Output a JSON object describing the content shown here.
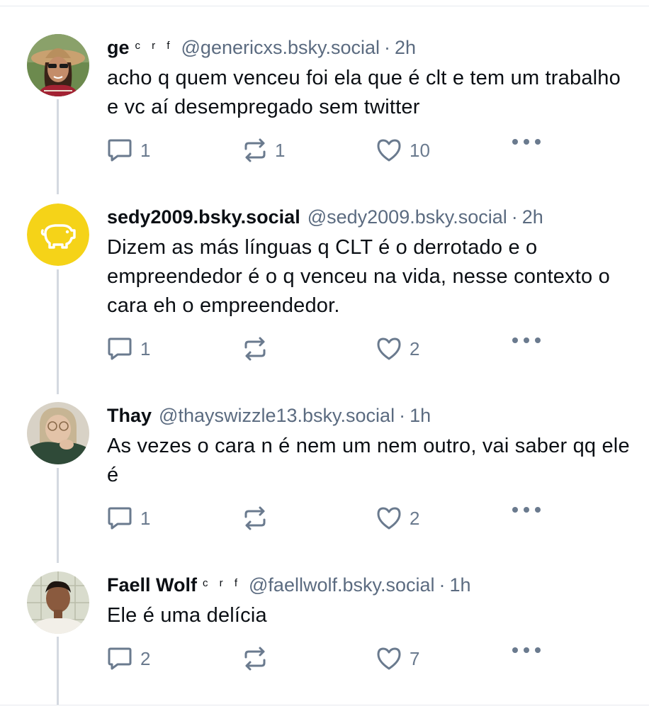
{
  "posts": [
    {
      "name": "ge",
      "name_suffix": "c r f",
      "handle": "@genericxs.bsky.social",
      "time": "2h",
      "text": "acho q quem venceu foi ela que é clt e tem um trabalho e vc aí desempregado sem twitter",
      "replies": "1",
      "reposts": "1",
      "likes": "10",
      "avatar": "photo-woman-hat"
    },
    {
      "name": "sedy2009.bsky.social",
      "name_suffix": "",
      "handle": "@sedy2009.bsky.social",
      "time": "2h",
      "text": "Dizem as más línguas q CLT é o derrotado e o empreendedor é o q venceu na vida, nesse contexto o cara eh o empreendedor.",
      "replies": "1",
      "reposts": "",
      "likes": "2",
      "avatar": "default-avatar-yellow"
    },
    {
      "name": "Thay",
      "name_suffix": "",
      "handle": "@thayswizzle13.bsky.social",
      "time": "1h",
      "text": "As vezes o cara n é nem um nem outro, vai saber qq ele é",
      "replies": "1",
      "reposts": "",
      "likes": "2",
      "avatar": "photo-woman-glasses"
    },
    {
      "name": "Faell Wolf",
      "name_suffix": "c r f",
      "handle": "@faellwolf.bsky.social",
      "time": "1h",
      "text": "Ele é uma delícia",
      "replies": "2",
      "reposts": "",
      "likes": "7",
      "avatar": "photo-man"
    }
  ],
  "separator": "·",
  "colors": {
    "text": "#0b0f14",
    "muted": "#5b6b80",
    "icon": "#6a7a8e",
    "thread_line": "#d4d9e0",
    "default_avatar": "#f5d318"
  }
}
